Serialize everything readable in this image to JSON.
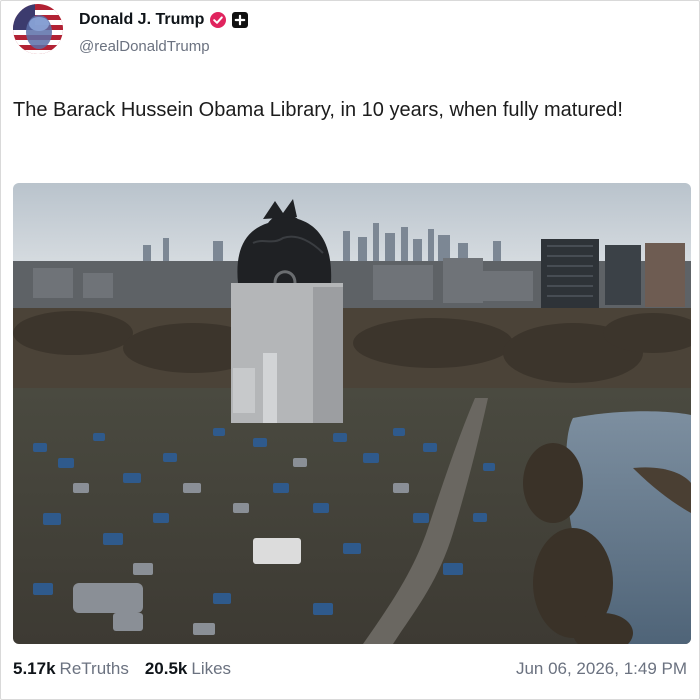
{
  "author": {
    "display_name": "Donald J. Trump",
    "handle": "@realDonaldTrump",
    "avatar_icon": "flag-portrait-avatar",
    "verified_icon": "verified-badge-icon",
    "verified_color": "#e0245e",
    "plus_icon": "plus-badge-icon"
  },
  "post": {
    "text": "The Barack Hussein Obama Library, in 10 years, when fully matured!",
    "media_description_icon": "photo-media"
  },
  "stats": {
    "retruths_count": "5.17k",
    "retruths_label": "ReTruths",
    "likes_count": "20.5k",
    "likes_label": "Likes"
  },
  "timestamp": "Jun 06, 2026, 1:49 PM"
}
